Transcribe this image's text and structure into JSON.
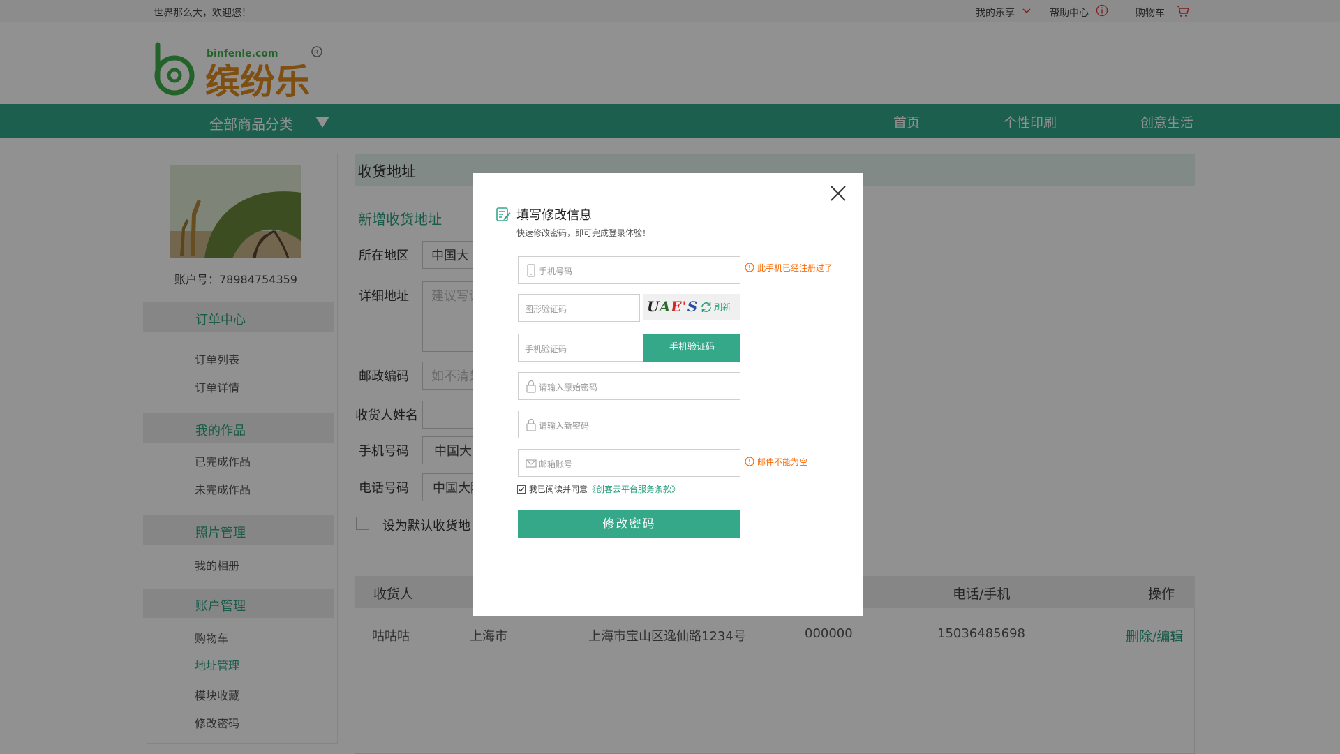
{
  "topbar": {
    "welcome": "世界那么大，欢迎您！",
    "mine": "我的乐享",
    "help": "帮助中心",
    "cart": "购物车"
  },
  "logo": {
    "site": "binfenle.com",
    "brand": "缤纷乐"
  },
  "nav": {
    "category": "全部商品分类",
    "links": [
      "首页",
      "个性印刷",
      "创意生活"
    ]
  },
  "sidebar": {
    "account": "账户号：78984754359",
    "sections": [
      {
        "title": "订单中心",
        "items": [
          "订单列表",
          "订单详情"
        ]
      },
      {
        "title": "我的作品",
        "items": [
          "已完成作品",
          "未完成作品"
        ]
      },
      {
        "title": "照片管理",
        "items": [
          "我的相册"
        ]
      },
      {
        "title": "账户管理",
        "items": [
          "购物车",
          "地址管理",
          "模块收藏",
          "修改密码"
        ],
        "active": "地址管理"
      }
    ]
  },
  "main": {
    "title": "收货地址",
    "add_title": "新增收货地址",
    "form": {
      "region_label": "所在地区",
      "region_value": "中国大",
      "address_label": "详细地址",
      "address_placeholder": "建议写详",
      "zip_label": "邮政编码",
      "zip_placeholder": "如不清楚",
      "name_label": "收货人姓名",
      "phone_label": "手机号码",
      "phone_value": "中国大",
      "tel_label": "电话号码",
      "tel_value": "中国大陆",
      "default_label": "设为默认收货地"
    },
    "table": {
      "headers": [
        "收货人",
        "电话/手机",
        "操作"
      ],
      "rows": [
        {
          "name": "咕咕咕",
          "city": "上海市",
          "address": "上海市宝山区逸仙路1234号",
          "zip": "000000",
          "phone": "15036485698",
          "action": "删除/编辑"
        }
      ]
    }
  },
  "modal": {
    "title": "填写修改信息",
    "subtitle": "快速修改密码，即可完成登录体验！",
    "phone_placeholder": "手机号码",
    "phone_error": "此手机已经注册过了",
    "img_code_placeholder": "图形验证码",
    "captcha_text": "UAE'S",
    "refresh": "刷新",
    "sms_code_placeholder": "手机验证码",
    "sms_button": "手机验证码",
    "old_pwd_placeholder": "请输入原始密码",
    "new_pwd_placeholder": "请输入新密码",
    "email_placeholder": "邮箱账号",
    "email_error": "邮件不能为空",
    "agree_text": "我已阅读并同意",
    "agree_link": "《创客云平台服务条款》",
    "submit": "修改密码"
  },
  "colors": {
    "accent": "#35a88a",
    "error": "#ff6a00",
    "overlay": "rgba(0,0,0,0.43)"
  }
}
